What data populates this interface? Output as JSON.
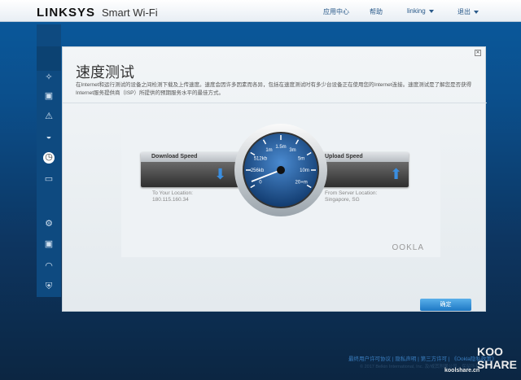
{
  "header": {
    "logo": "LINKSYS",
    "product": "Smart Wi-Fi",
    "nav": [
      "应用中心",
      "帮助",
      "linking",
      "退出"
    ]
  },
  "sidebar": {
    "icons": [
      "back-icon",
      "devices-icon",
      "network-map-icon",
      "troubleshooting-icon",
      "wireless-icon",
      "speed-test-icon",
      "external-storage-icon",
      "connectivity-icon",
      "media-prioritization-icon",
      "wifi-settings-icon",
      "security-icon"
    ]
  },
  "modal": {
    "title": "速度测试",
    "description": "在Internet和运行测试的设备之间检测下载及上传速度。速度会因许多因素而各异，包括在速度测试时有多少台设备正在使用您的Internet连接。速度测试是了解您是否获得Internet服务提供商（ISP）所提供的预期服务水平的最佳方式。",
    "download_label": "Download Speed",
    "upload_label": "Upload Speed",
    "to_location_label": "To Your Location:",
    "to_location": "180.115.160.34",
    "from_location_label": "From Server Location:",
    "from_location": "Singapore, SG",
    "gauge_ticks": [
      "0",
      "256kb",
      "512kb",
      "1m",
      "1.5m",
      "3m",
      "5m",
      "10m",
      "20+m"
    ],
    "brand": "OOKLA",
    "ok_button": "确定"
  },
  "footer": {
    "links": [
      "最终用户许可协议",
      "隐私声明",
      "第三方许可",
      "《Ookla隐私政策》"
    ],
    "copyright": "© 2017 Belkin International, Inc. 及/或其附属公司。保留所有权利。"
  },
  "watermark": {
    "brand": "KOOLSHARE",
    "url": "koolshare.cn"
  }
}
